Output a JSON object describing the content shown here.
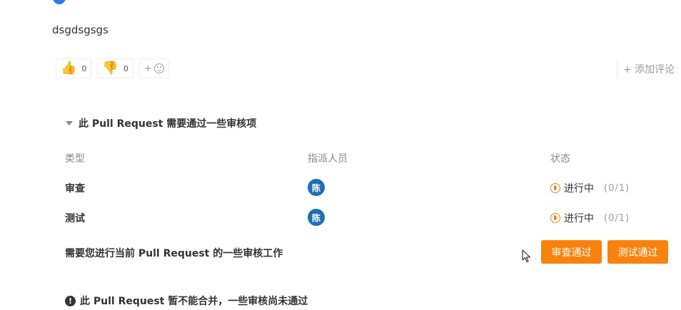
{
  "comment": {
    "body": "dsgdsgsgs",
    "reactions": [
      {
        "icon": "thumbs-up-icon",
        "glyph": "👍",
        "count": "0"
      },
      {
        "icon": "thumbs-down-icon",
        "glyph": "👎",
        "count": "0"
      }
    ],
    "add_emoji_label": "+",
    "add_comment_label": "+ 添加评论"
  },
  "review": {
    "header": "此 Pull Request 需要通过一些审核项",
    "columns": {
      "type": "类型",
      "assignee": "指派人员",
      "status": "状态"
    },
    "rows": [
      {
        "type": "审查",
        "assignee_initial": "陈",
        "status": "进行中",
        "progress": "(0/1)"
      },
      {
        "type": "测试",
        "assignee_initial": "陈",
        "status": "进行中",
        "progress": "(0/1)"
      }
    ],
    "task_text": "需要您进行当前 Pull Request 的一些审核工作",
    "approve_review_label": "审查通过",
    "approve_test_label": "测试通过",
    "warning": "此 Pull Request 暂不能合并，一些审核尚未通过",
    "warning_glyph": "!"
  },
  "colors": {
    "accent_orange": "#f7830e",
    "status_orange": "#f08519",
    "avatar_blue": "#1f6fb2"
  }
}
